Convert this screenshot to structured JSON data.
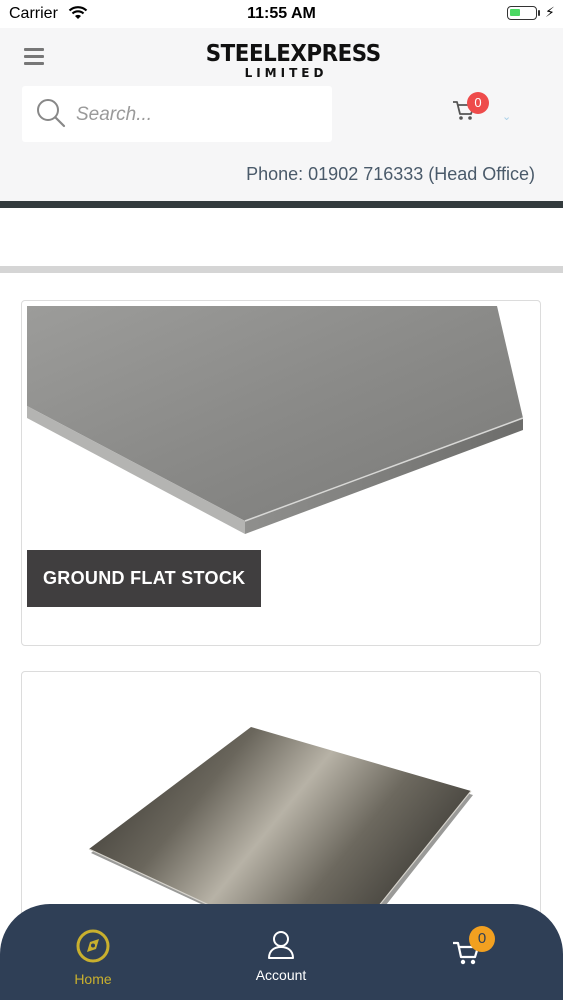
{
  "status_bar": {
    "carrier": "Carrier",
    "time": "11:55 AM"
  },
  "header": {
    "logo_line1": "STEELEXPRESS",
    "logo_line2": "LIMITED",
    "search_placeholder": "Search...",
    "cart_count": "0",
    "phone": "Phone: 01902 716333 (Head Office)"
  },
  "products": [
    {
      "label": "GROUND FLAT STOCK",
      "image": "steel-flat-bar-image"
    },
    {
      "label": "",
      "image": "steel-sheet-image"
    }
  ],
  "bottom_nav": {
    "home": "Home",
    "account": "Account",
    "cart_count": "0"
  },
  "colors": {
    "nav_background": "#2f3f56",
    "nav_active": "#c9b02e",
    "header_badge": "#ee4b4b",
    "nav_badge": "#f2a020",
    "label_background": "#403e3f"
  }
}
